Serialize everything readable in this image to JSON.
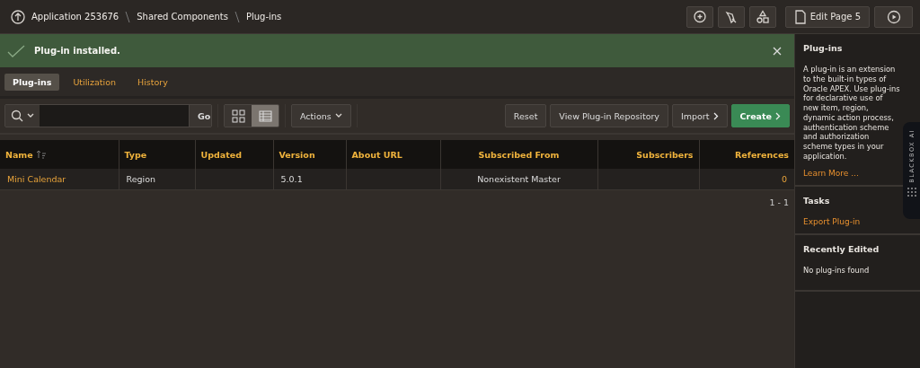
{
  "breadcrumb": [
    "Application 253676",
    "Shared Components",
    "Plug-ins"
  ],
  "edit_page_button": "Edit Page 5",
  "banner": {
    "message": "Plug-in installed."
  },
  "tabs": [
    {
      "label": "Plug-ins",
      "selected": true
    },
    {
      "label": "Utilization",
      "selected": false
    },
    {
      "label": "History",
      "selected": false
    }
  ],
  "toolbar": {
    "go_button": "Go",
    "views": [
      {
        "kind": "icons",
        "selected": false
      },
      {
        "kind": "report",
        "selected": true
      }
    ],
    "actions_button": "Actions",
    "buttons": [
      {
        "label": "Reset",
        "kind": "plain"
      },
      {
        "label": "View Plug-in Repository",
        "kind": "plain"
      },
      {
        "label": "Import",
        "kind": "menu"
      },
      {
        "label": "Create",
        "kind": "primary"
      }
    ]
  },
  "table": {
    "columns": [
      {
        "label": "Name",
        "sorted": true
      },
      {
        "label": "Type",
        "sorted": false
      },
      {
        "label": "Updated",
        "sorted": false
      },
      {
        "label": "Version",
        "sorted": false
      },
      {
        "label": "About URL",
        "sorted": false
      },
      {
        "label": "Subscribed From",
        "sorted": false
      },
      {
        "label": "Subscribers",
        "sorted": false
      },
      {
        "label": "References",
        "sorted": false
      }
    ],
    "rows": [
      {
        "name": "Mini Calendar",
        "type": "Region",
        "version": "5.0.1",
        "subscribed_from": "Nonexistent Master",
        "references": "0"
      }
    ],
    "pagination": "1 - 1"
  },
  "sidebar": {
    "sections": [
      {
        "title": "Plug-ins",
        "text": "A plug-in is an extension to the built-in types of Oracle APEX. Use plug-ins for declarative use of new item, region, dynamic action process, authentication scheme and authorization scheme types in your application.",
        "link": "Learn More ..."
      },
      {
        "title": "Tasks",
        "link": "Export Plug-in"
      },
      {
        "title": "Recently Edited",
        "text": "No plug-ins found"
      }
    ]
  },
  "extension_tab": {
    "label": "BLACKBOX AI"
  }
}
